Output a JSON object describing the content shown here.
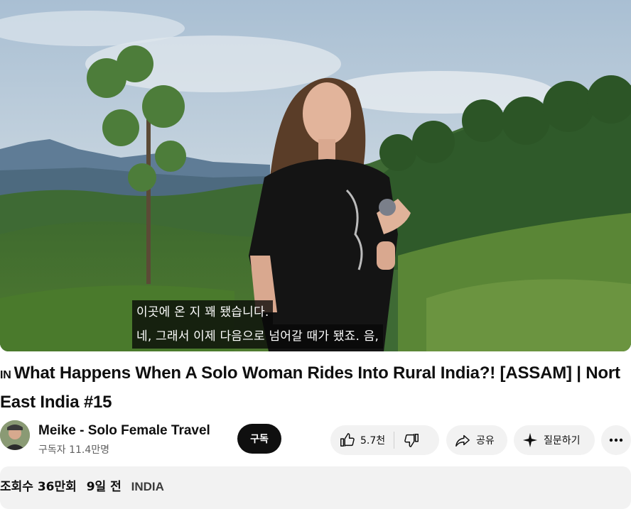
{
  "player": {
    "captions": [
      "이곳에 온 지 꽤 됐습니다.",
      "네, 그래서 이제 다음으로 넘어갈 때가 됐죠.  음,"
    ]
  },
  "video": {
    "flag": "IN",
    "title": "What Happens When A Solo Woman Rides Into Rural India?! [ASSAM] | Nort East India #15"
  },
  "channel": {
    "name": "Meike - Solo Female Travel",
    "subscribers": "구독자 11.4만명",
    "subscribe_label": "구독"
  },
  "actions": {
    "like_count": "5.7천",
    "share_label": "공유",
    "ask_label": "질문하기"
  },
  "description": {
    "views": "조회수 36만회",
    "age": "9일 전",
    "tag": "INDIA"
  },
  "colors": {
    "subscribe_bg": "#0f0f0f",
    "pill_bg": "#f2f2f2",
    "caption_bg": "#080808"
  },
  "icons": [
    "thumbs-up-icon",
    "thumbs-down-icon",
    "share-icon",
    "sparkle-icon",
    "more-icon"
  ]
}
